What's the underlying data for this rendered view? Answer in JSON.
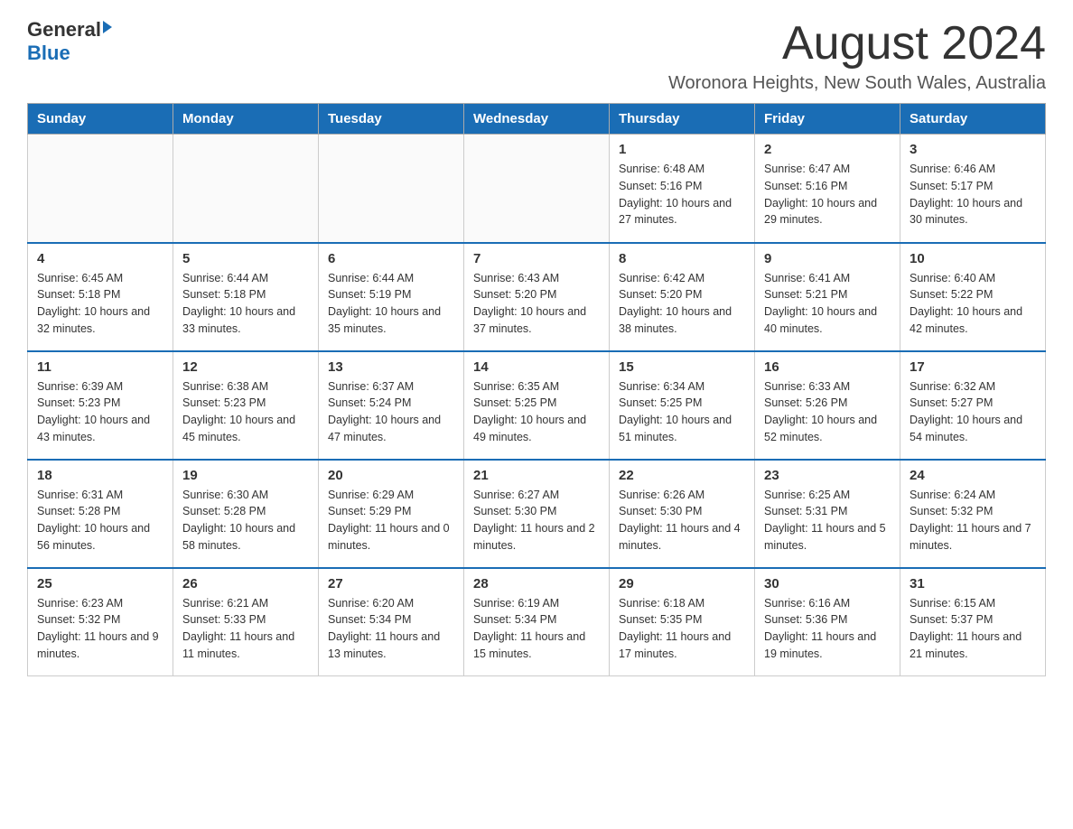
{
  "header": {
    "logo_general": "General",
    "logo_blue": "Blue",
    "month_title": "August 2024",
    "location": "Woronora Heights, New South Wales, Australia"
  },
  "days_of_week": [
    "Sunday",
    "Monday",
    "Tuesday",
    "Wednesday",
    "Thursday",
    "Friday",
    "Saturday"
  ],
  "weeks": [
    [
      {
        "day": "",
        "info": ""
      },
      {
        "day": "",
        "info": ""
      },
      {
        "day": "",
        "info": ""
      },
      {
        "day": "",
        "info": ""
      },
      {
        "day": "1",
        "info": "Sunrise: 6:48 AM\nSunset: 5:16 PM\nDaylight: 10 hours and 27 minutes."
      },
      {
        "day": "2",
        "info": "Sunrise: 6:47 AM\nSunset: 5:16 PM\nDaylight: 10 hours and 29 minutes."
      },
      {
        "day": "3",
        "info": "Sunrise: 6:46 AM\nSunset: 5:17 PM\nDaylight: 10 hours and 30 minutes."
      }
    ],
    [
      {
        "day": "4",
        "info": "Sunrise: 6:45 AM\nSunset: 5:18 PM\nDaylight: 10 hours and 32 minutes."
      },
      {
        "day": "5",
        "info": "Sunrise: 6:44 AM\nSunset: 5:18 PM\nDaylight: 10 hours and 33 minutes."
      },
      {
        "day": "6",
        "info": "Sunrise: 6:44 AM\nSunset: 5:19 PM\nDaylight: 10 hours and 35 minutes."
      },
      {
        "day": "7",
        "info": "Sunrise: 6:43 AM\nSunset: 5:20 PM\nDaylight: 10 hours and 37 minutes."
      },
      {
        "day": "8",
        "info": "Sunrise: 6:42 AM\nSunset: 5:20 PM\nDaylight: 10 hours and 38 minutes."
      },
      {
        "day": "9",
        "info": "Sunrise: 6:41 AM\nSunset: 5:21 PM\nDaylight: 10 hours and 40 minutes."
      },
      {
        "day": "10",
        "info": "Sunrise: 6:40 AM\nSunset: 5:22 PM\nDaylight: 10 hours and 42 minutes."
      }
    ],
    [
      {
        "day": "11",
        "info": "Sunrise: 6:39 AM\nSunset: 5:23 PM\nDaylight: 10 hours and 43 minutes."
      },
      {
        "day": "12",
        "info": "Sunrise: 6:38 AM\nSunset: 5:23 PM\nDaylight: 10 hours and 45 minutes."
      },
      {
        "day": "13",
        "info": "Sunrise: 6:37 AM\nSunset: 5:24 PM\nDaylight: 10 hours and 47 minutes."
      },
      {
        "day": "14",
        "info": "Sunrise: 6:35 AM\nSunset: 5:25 PM\nDaylight: 10 hours and 49 minutes."
      },
      {
        "day": "15",
        "info": "Sunrise: 6:34 AM\nSunset: 5:25 PM\nDaylight: 10 hours and 51 minutes."
      },
      {
        "day": "16",
        "info": "Sunrise: 6:33 AM\nSunset: 5:26 PM\nDaylight: 10 hours and 52 minutes."
      },
      {
        "day": "17",
        "info": "Sunrise: 6:32 AM\nSunset: 5:27 PM\nDaylight: 10 hours and 54 minutes."
      }
    ],
    [
      {
        "day": "18",
        "info": "Sunrise: 6:31 AM\nSunset: 5:28 PM\nDaylight: 10 hours and 56 minutes."
      },
      {
        "day": "19",
        "info": "Sunrise: 6:30 AM\nSunset: 5:28 PM\nDaylight: 10 hours and 58 minutes."
      },
      {
        "day": "20",
        "info": "Sunrise: 6:29 AM\nSunset: 5:29 PM\nDaylight: 11 hours and 0 minutes."
      },
      {
        "day": "21",
        "info": "Sunrise: 6:27 AM\nSunset: 5:30 PM\nDaylight: 11 hours and 2 minutes."
      },
      {
        "day": "22",
        "info": "Sunrise: 6:26 AM\nSunset: 5:30 PM\nDaylight: 11 hours and 4 minutes."
      },
      {
        "day": "23",
        "info": "Sunrise: 6:25 AM\nSunset: 5:31 PM\nDaylight: 11 hours and 5 minutes."
      },
      {
        "day": "24",
        "info": "Sunrise: 6:24 AM\nSunset: 5:32 PM\nDaylight: 11 hours and 7 minutes."
      }
    ],
    [
      {
        "day": "25",
        "info": "Sunrise: 6:23 AM\nSunset: 5:32 PM\nDaylight: 11 hours and 9 minutes."
      },
      {
        "day": "26",
        "info": "Sunrise: 6:21 AM\nSunset: 5:33 PM\nDaylight: 11 hours and 11 minutes."
      },
      {
        "day": "27",
        "info": "Sunrise: 6:20 AM\nSunset: 5:34 PM\nDaylight: 11 hours and 13 minutes."
      },
      {
        "day": "28",
        "info": "Sunrise: 6:19 AM\nSunset: 5:34 PM\nDaylight: 11 hours and 15 minutes."
      },
      {
        "day": "29",
        "info": "Sunrise: 6:18 AM\nSunset: 5:35 PM\nDaylight: 11 hours and 17 minutes."
      },
      {
        "day": "30",
        "info": "Sunrise: 6:16 AM\nSunset: 5:36 PM\nDaylight: 11 hours and 19 minutes."
      },
      {
        "day": "31",
        "info": "Sunrise: 6:15 AM\nSunset: 5:37 PM\nDaylight: 11 hours and 21 minutes."
      }
    ]
  ]
}
